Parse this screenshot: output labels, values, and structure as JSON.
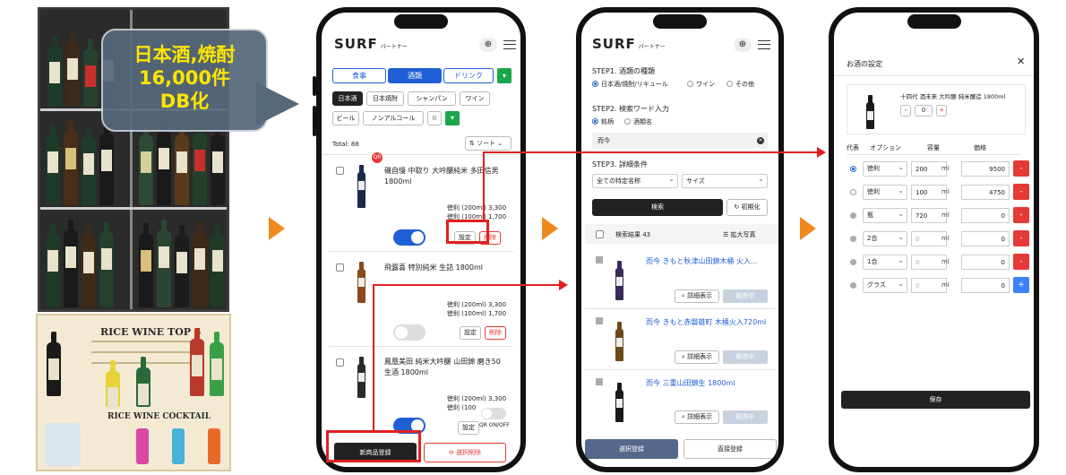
{
  "callout": {
    "line1": "日本酒,焼酎",
    "line2": "16,000件",
    "line3": "DB化"
  },
  "menu_photo": {
    "title": "RICE WINE TOP 5",
    "subtitle": "RICE WINE COCKTAIL"
  },
  "colors": {
    "accent_blue": "#1f5fd6",
    "red": "#e02020",
    "orange": "#ef8a1e",
    "green": "#1aa64a",
    "dark": "#222222"
  },
  "phone1": {
    "brand": "SURF",
    "brand_sub": "パートナー",
    "categories": [
      "食事",
      "酒類",
      "ドリンク"
    ],
    "subcategories": [
      "日本酒",
      "日本焼酎",
      "シャンパン",
      "ワイン",
      "ビール",
      "ノンアルコール"
    ],
    "total": "Total: 88",
    "sort": "ソート",
    "items": [
      {
        "name": "磯自慢 中取り 大吟醸純米 多田信男 1800ml",
        "price1": "徳利 (200ml) 3,300",
        "price2": "徳利 (100ml) 1,700",
        "toggle": "on"
      },
      {
        "name": "飛露喜 特別純米 生詰 1800ml",
        "price1": "徳利 (200ml) 3,300",
        "price2": "徳利 (100ml) 1,700",
        "toggle": "off"
      },
      {
        "name": "鳳凰美田 純米大吟醸 山田錦 磨き50 生酒 1800ml",
        "price1": "徳利 (200ml) 3,300",
        "price2": "徳利 (100",
        "toggle": "on"
      }
    ],
    "settings_label": "設定",
    "delete_label": "削除",
    "qr_label": "QR ON/OFF",
    "new_item": "新商品登録",
    "bulk_delete": "選択削除"
  },
  "phone2": {
    "step1": "STEP1. 酒類の種類",
    "types": [
      "日本酒/焼酎/リキュール",
      "ワイン",
      "その他"
    ],
    "step2": "STEP2. 検索ワード入力",
    "search_modes": [
      "銘柄",
      "酒類名"
    ],
    "search_value": "而今",
    "step3": "STEP3. 詳細条件",
    "filter1": "全ての特定名称",
    "filter2": "サイズ",
    "search_btn": "検索",
    "reset_btn": "初期化",
    "results": "検索結果 43",
    "enlarge": "拡大写真",
    "result_items": [
      "而今 きもと秋津山田錦木桶 火入...",
      "而今 きもと赤磐雄町 木桶火入720ml",
      "而今 三重山田錦生 1800ml"
    ],
    "detail": "詳細表示",
    "sale": "販売中",
    "select_reg": "選択登録",
    "direct_reg": "直接登録"
  },
  "phone3": {
    "title": "お酒の設定",
    "product": "十四代 酒未来 大吟醸 純米醸造 1800ml",
    "qty": "0",
    "headers": [
      "代表",
      "オプション",
      "容量",
      "価格"
    ],
    "rows": [
      {
        "option": "徳利",
        "vol": "200",
        "unit": "ml",
        "price": "9500",
        "action": "-"
      },
      {
        "option": "徳利",
        "vol": "100",
        "unit": "ml",
        "price": "4750",
        "action": "-"
      },
      {
        "option": "瓶",
        "vol": "720",
        "unit": "ml",
        "price": "0",
        "action": "-"
      },
      {
        "option": "2合",
        "vol": "0",
        "unit": "ml",
        "price": "0",
        "action": "-"
      },
      {
        "option": "1合",
        "vol": "0",
        "unit": "ml",
        "price": "0",
        "action": "-"
      },
      {
        "option": "グラス",
        "vol": "0",
        "unit": "ml",
        "price": "0",
        "action": "+"
      }
    ],
    "save": "保存"
  }
}
